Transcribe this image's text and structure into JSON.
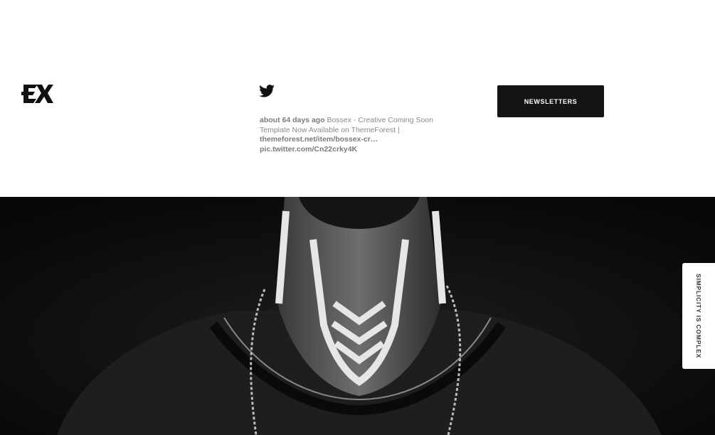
{
  "brand": {
    "logo_text": "EX"
  },
  "tweet": {
    "time": "about 64 days ago",
    "text": "Bossex - Creative Coming Soon Template Now Available on ThemeForest |",
    "link1": "themeforest.net/item/bossex-cr…",
    "link2": "pic.twitter.com/Cn22crky4K"
  },
  "newsletter": {
    "label": "NEWSLETTERS"
  },
  "side_tab": {
    "label": "SIMPLICITY IS COMPLEX"
  },
  "icons": [
    "ex-logo-icon",
    "twitter-icon"
  ]
}
